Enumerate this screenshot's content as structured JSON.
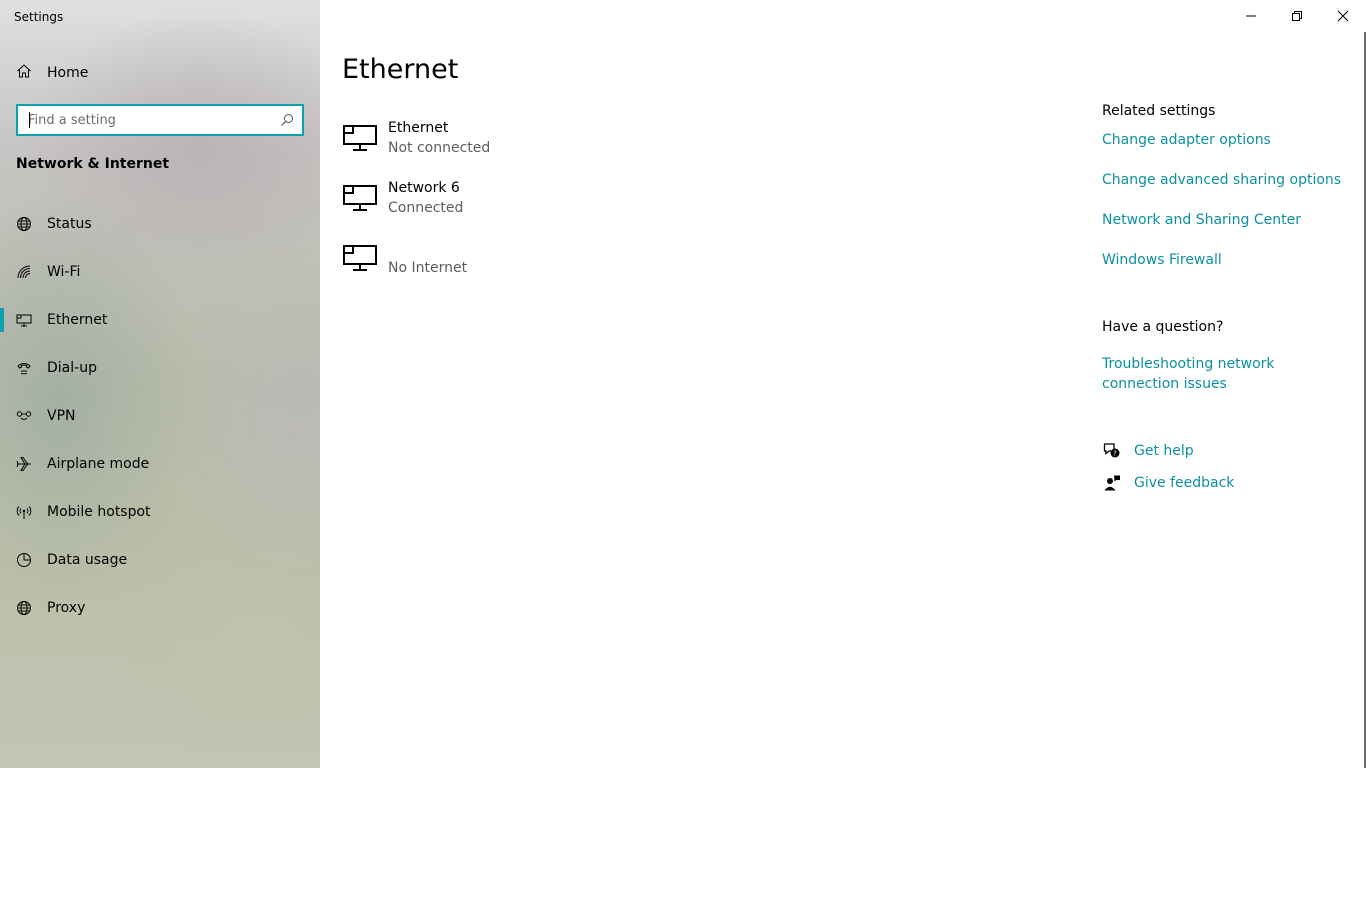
{
  "app": {
    "title": "Settings"
  },
  "sidebar": {
    "home_label": "Home",
    "search_placeholder": "Find a setting",
    "section_title": "Network & Internet",
    "items": [
      {
        "label": "Status",
        "icon": "globe-status-icon"
      },
      {
        "label": "Wi-Fi",
        "icon": "wifi-icon"
      },
      {
        "label": "Ethernet",
        "icon": "ethernet-icon",
        "active": true
      },
      {
        "label": "Dial-up",
        "icon": "dialup-icon"
      },
      {
        "label": "VPN",
        "icon": "vpn-icon"
      },
      {
        "label": "Airplane mode",
        "icon": "airplane-icon"
      },
      {
        "label": "Mobile hotspot",
        "icon": "hotspot-icon"
      },
      {
        "label": "Data usage",
        "icon": "data-usage-icon"
      },
      {
        "label": "Proxy",
        "icon": "globe-icon"
      }
    ]
  },
  "main": {
    "title": "Ethernet",
    "networks": [
      {
        "name": "Ethernet",
        "status": "Not connected"
      },
      {
        "name": "Network 6",
        "status": "Connected"
      },
      {
        "name": "",
        "status": "No Internet"
      }
    ]
  },
  "related": {
    "heading": "Related settings",
    "links": [
      "Change adapter options",
      "Change advanced sharing options",
      "Network and Sharing Center",
      "Windows Firewall"
    ]
  },
  "question": {
    "heading": "Have a question?",
    "link_line1": "Troubleshooting network",
    "link_line2": "connection issues"
  },
  "help": {
    "get_help": "Get help",
    "give_feedback": "Give feedback"
  },
  "colors": {
    "accent": "#0aa1b0",
    "link": "#0c8fa3"
  }
}
